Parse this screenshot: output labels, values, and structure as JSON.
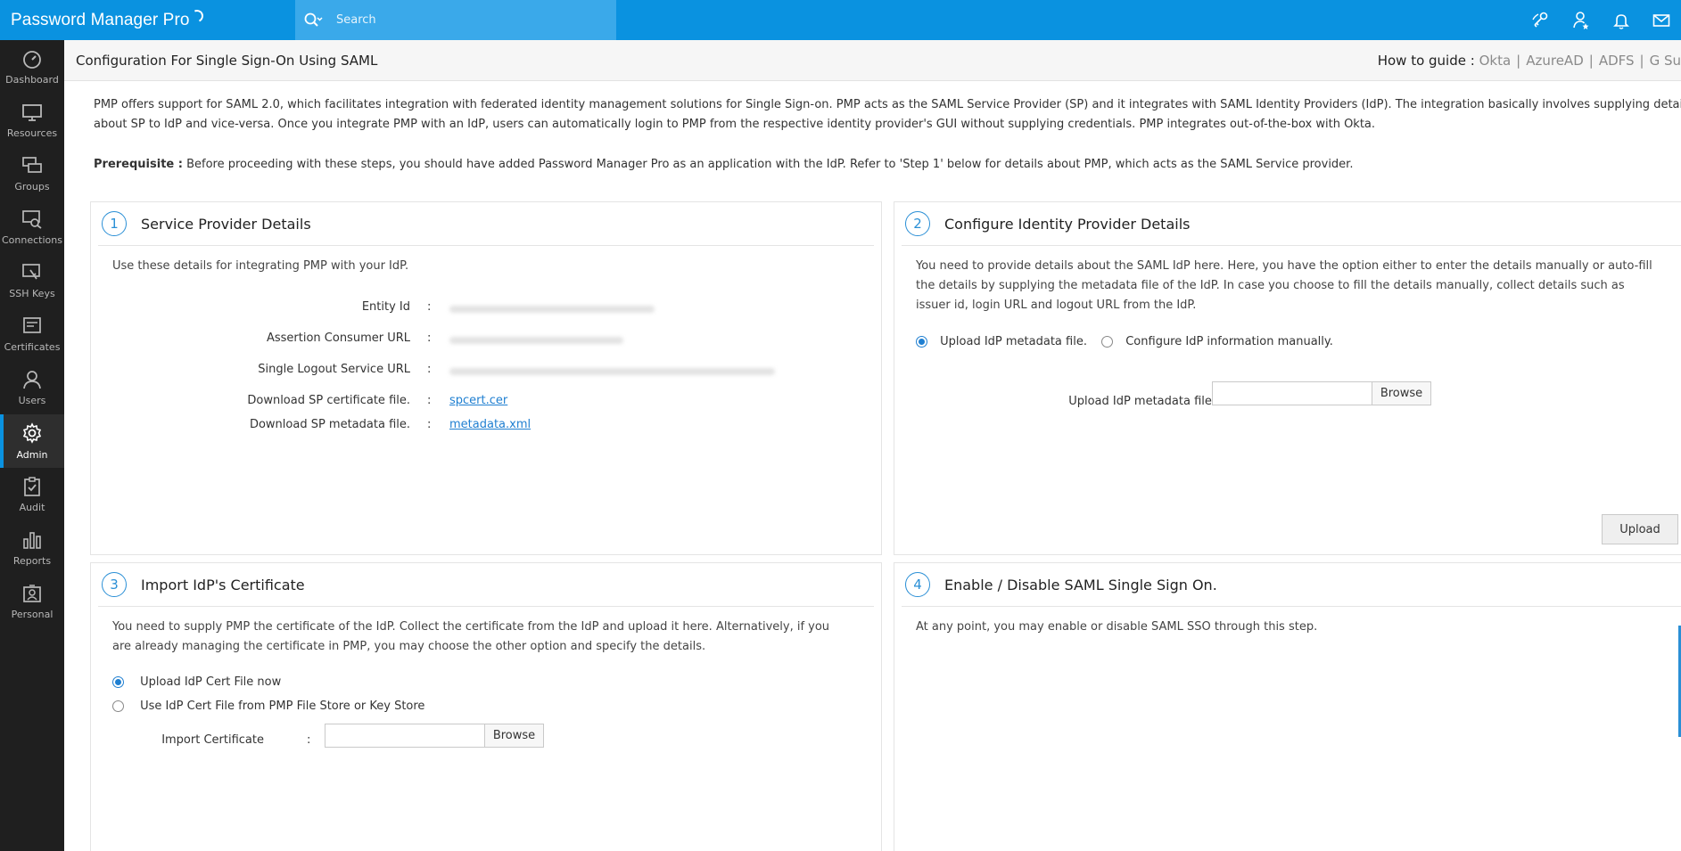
{
  "app": {
    "brand": "Password Manager Pro"
  },
  "search": {
    "placeholder": "Search"
  },
  "topbar_icons": [
    "link-key-icon",
    "user-star-icon",
    "bell-icon",
    "mail-icon"
  ],
  "nav": {
    "items": [
      {
        "label": "Dashboard",
        "icon": "dashboard-icon"
      },
      {
        "label": "Resources",
        "icon": "monitor-icon"
      },
      {
        "label": "Groups",
        "icon": "groups-icon"
      },
      {
        "label": "Connections",
        "icon": "connections-icon"
      },
      {
        "label": "SSH Keys",
        "icon": "ssh-key-icon"
      },
      {
        "label": "Certificates",
        "icon": "certificate-icon"
      },
      {
        "label": "Users",
        "icon": "user-icon"
      },
      {
        "label": "Admin",
        "icon": "gear-icon",
        "active": true
      },
      {
        "label": "Audit",
        "icon": "clipboard-check-icon"
      },
      {
        "label": "Reports",
        "icon": "bar-chart-icon"
      },
      {
        "label": "Personal",
        "icon": "personal-icon"
      }
    ],
    "accent": "#0a92e0"
  },
  "page": {
    "title": "Configuration For Single Sign-On Using SAML",
    "guide_label": "How to guide :",
    "guides": [
      "Okta",
      "AzureAD",
      "ADFS",
      "G Su"
    ]
  },
  "intro": {
    "text": "PMP offers support for SAML 2.0, which facilitates integration with federated identity management solutions for Single Sign-on. PMP acts as the SAML Service Provider (SP) and it integrates with SAML Identity Providers (IdP). The integration basically involves supplying details about SP to IdP and vice-versa. Once you integrate PMP with an IdP, users can automatically login to PMP from the respective identity provider's GUI without supplying credentials. PMP integrates out-of-the-box with Okta.",
    "prereq_label": "Prerequisite :",
    "prereq_text": " Before proceeding with these steps, you should have added Password Manager Pro as an application with the IdP. Refer to 'Step 1' below for details about PMP, which acts as the SAML Service provider."
  },
  "step1": {
    "num": "1",
    "title": "Service Provider Details",
    "desc": "Use these details for integrating PMP with your IdP.",
    "fields": {
      "entity_id": "Entity Id",
      "acs_url": "Assertion Consumer URL",
      "slo_url": "Single Logout Service URL",
      "sp_cert": "Download SP certificate file.",
      "sp_meta": "Download SP metadata file."
    },
    "colon": ":",
    "sp_cert_link": "spcert.cer",
    "sp_meta_link": "metadata.xml"
  },
  "step2": {
    "num": "2",
    "title": "Configure Identity Provider Details",
    "desc": "You need to provide details about the SAML IdP here. Here, you have the option either to enter the details manually or auto-fill the details by supplying the metadata file of the IdP. In case you choose to fill the details manually, collect details such as issuer id, login URL and logout URL from the IdP.",
    "radio_upload": "Upload IdP metadata file.",
    "radio_manual": "Configure IdP information manually.",
    "upload_label": "Upload IdP metadata file.",
    "colon": ":",
    "browse": "Browse",
    "upload_btn": "Upload"
  },
  "step3": {
    "num": "3",
    "title": "Import IdP's Certificate",
    "desc": "You need to supply PMP the certificate of the IdP. Collect the certificate from the IdP and upload it here. Alternatively, if you are already managing the certificate in PMP, you may choose the other option and specify the details.",
    "radio_upload": "Upload IdP Cert File now",
    "radio_store": "Use IdP Cert File from PMP File Store or Key Store",
    "import_label": "Import Certificate",
    "colon": ":",
    "browse": "Browse"
  },
  "step4": {
    "num": "4",
    "title": "Enable / Disable SAML Single Sign On.",
    "desc": "At any point, you may enable or disable SAML SSO through this step."
  }
}
